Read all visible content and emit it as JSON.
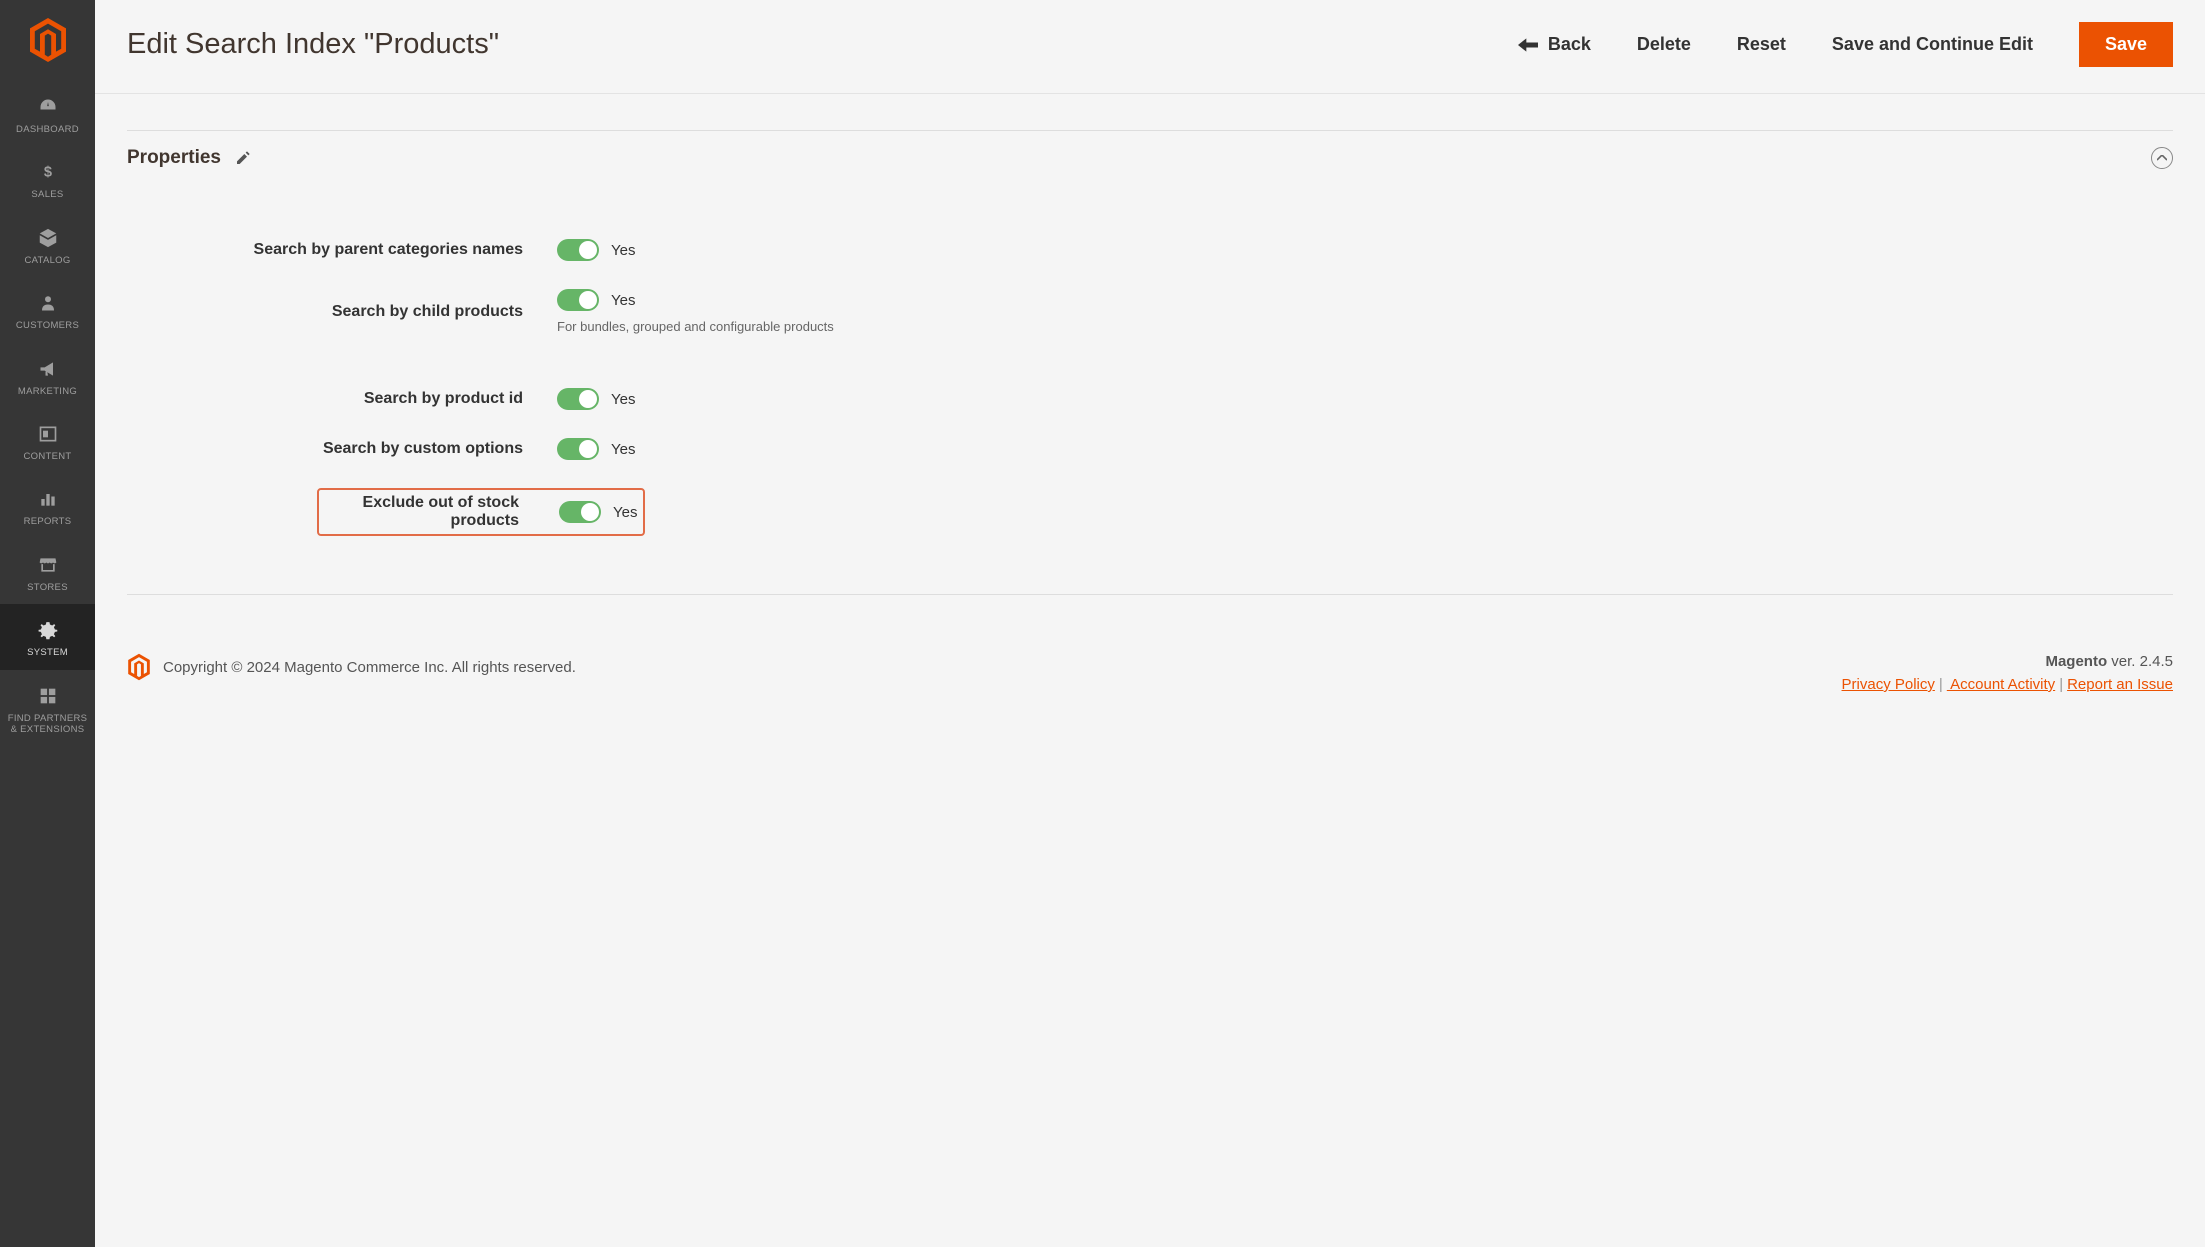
{
  "sidebar": {
    "items": [
      {
        "label": "DASHBOARD",
        "icon": "dashboard"
      },
      {
        "label": "SALES",
        "icon": "sales"
      },
      {
        "label": "CATALOG",
        "icon": "catalog"
      },
      {
        "label": "CUSTOMERS",
        "icon": "customers"
      },
      {
        "label": "MARKETING",
        "icon": "marketing"
      },
      {
        "label": "CONTENT",
        "icon": "content"
      },
      {
        "label": "REPORTS",
        "icon": "reports"
      },
      {
        "label": "STORES",
        "icon": "stores"
      },
      {
        "label": "SYSTEM",
        "icon": "system",
        "active": true
      },
      {
        "label": "FIND PARTNERS & EXTENSIONS",
        "icon": "partners"
      }
    ]
  },
  "header": {
    "title": "Edit Search Index \"Products\"",
    "back": "Back",
    "delete": "Delete",
    "reset": "Reset",
    "save_continue": "Save and Continue Edit",
    "save": "Save"
  },
  "section": {
    "title": "Properties"
  },
  "fields": {
    "parent_categories": {
      "label": "Search by parent categories names",
      "value": "Yes"
    },
    "child_products": {
      "label": "Search by child products",
      "value": "Yes",
      "help": "For bundles, grouped and configurable products"
    },
    "product_id": {
      "label": "Search by product id",
      "value": "Yes"
    },
    "custom_options": {
      "label": "Search by custom options",
      "value": "Yes"
    },
    "exclude_oos": {
      "label": "Exclude out of stock products",
      "value": "Yes"
    }
  },
  "footer": {
    "copyright": "Copyright © 2024 Magento Commerce Inc. All rights reserved.",
    "brand": "Magento",
    "version": " ver. 2.4.5",
    "privacy": "Privacy Policy",
    "activity": " Account Activity",
    "report": "Report an Issue"
  }
}
